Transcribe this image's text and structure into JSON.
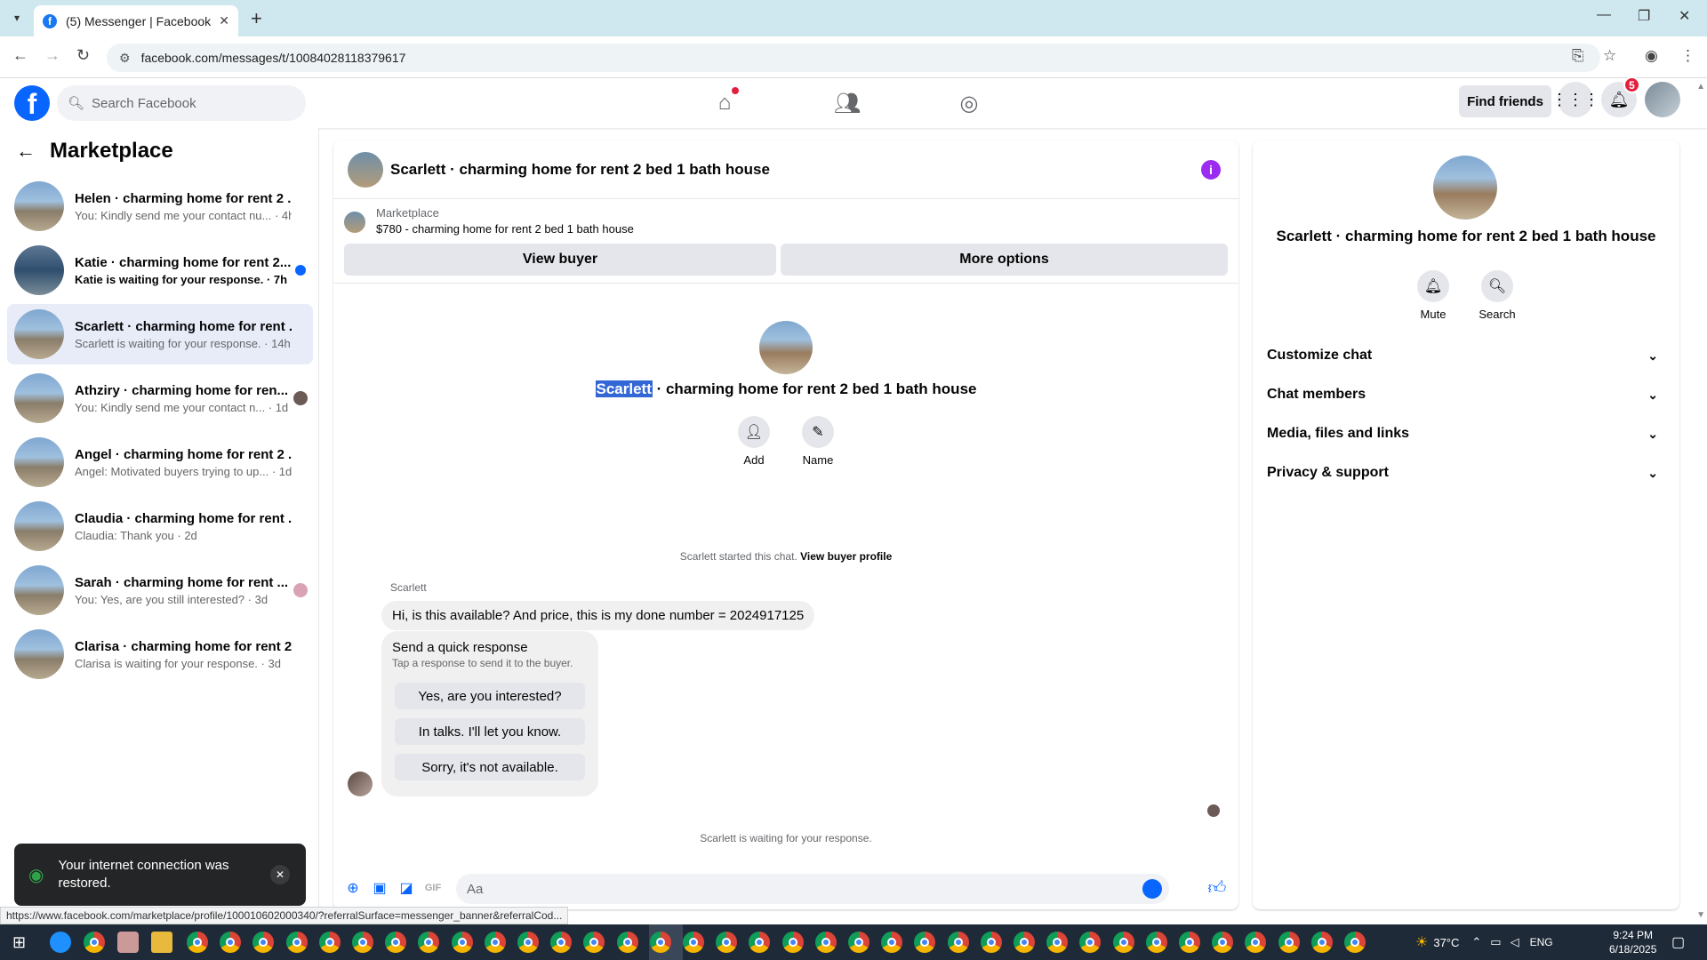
{
  "browser": {
    "tab_title": "(5) Messenger | Facebook",
    "url": "facebook.com/messages/t/10084028118379617",
    "status_url": "https://www.facebook.com/marketplace/profile/100010602000340/?referralSurface=messenger_banner&referralCod..."
  },
  "fb": {
    "search_placeholder": "Search Facebook",
    "find_friends": "Find friends",
    "notif_count": "5"
  },
  "left": {
    "title": "Marketplace",
    "conversations": [
      {
        "name": "Helen · charming home for rent 2 ...",
        "sub": "You: Kindly send me your contact nu... · 4h"
      },
      {
        "name": "Katie · charming home for rent 2...",
        "sub": "Katie is waiting for your response. · 7h"
      },
      {
        "name": "Scarlett · charming home for rent ...",
        "sub": "Scarlett is waiting for your response. · 14h"
      },
      {
        "name": "Athziry · charming home for ren...",
        "sub": "You: Kindly send me your contact n... · 1d"
      },
      {
        "name": "Angel · charming home for rent 2 ...",
        "sub": "Angel: Motivated buyers trying to up... · 1d"
      },
      {
        "name": "Claudia · charming home for rent ...",
        "sub": "Claudia: Thank you · 2d"
      },
      {
        "name": "Sarah · charming home for rent ...",
        "sub": "You: Yes, are you still interested? · 3d"
      },
      {
        "name": "Clarisa · charming home for rent 2...",
        "sub": "Clarisa is waiting for your response. · 3d"
      }
    ]
  },
  "toast": {
    "message": "Your internet connection was restored."
  },
  "chat": {
    "header_title": "Scarlett · charming home for rent 2 bed 1 bath house",
    "banner_label": "Marketplace",
    "banner_listing": "$780 - charming home for rent 2 bed 1 bath house",
    "view_buyer": "View buyer",
    "more_options": "More options",
    "center_name_highlight": "Scarlett",
    "center_name_rest": " · charming home for rent 2 bed 1 bath house",
    "add_label": "Add",
    "name_label": "Name",
    "started_text": "Scarlett started this chat.",
    "view_buyer_profile": "View buyer profile",
    "sender": "Scarlett",
    "message": "Hi, is this available? And price, this is my done number = 2024917125",
    "quick_title": "Send a quick response",
    "quick_sub": "Tap a response to send it to the buyer.",
    "quick_options": [
      "Yes, are you interested?",
      "In talks. I'll let you know.",
      "Sorry, it's not available."
    ],
    "waiting_text": "Scarlett is waiting for your response.",
    "composer_placeholder": "Aa"
  },
  "right": {
    "title": "Scarlett · charming home for rent 2 bed 1 bath house",
    "mute": "Mute",
    "search": "Search",
    "sections": [
      "Customize chat",
      "Chat members",
      "Media, files and links",
      "Privacy & support"
    ]
  },
  "taskbar": {
    "temperature": "37°C",
    "lang": "ENG",
    "time": "9:24 PM",
    "date": "6/18/2025"
  }
}
